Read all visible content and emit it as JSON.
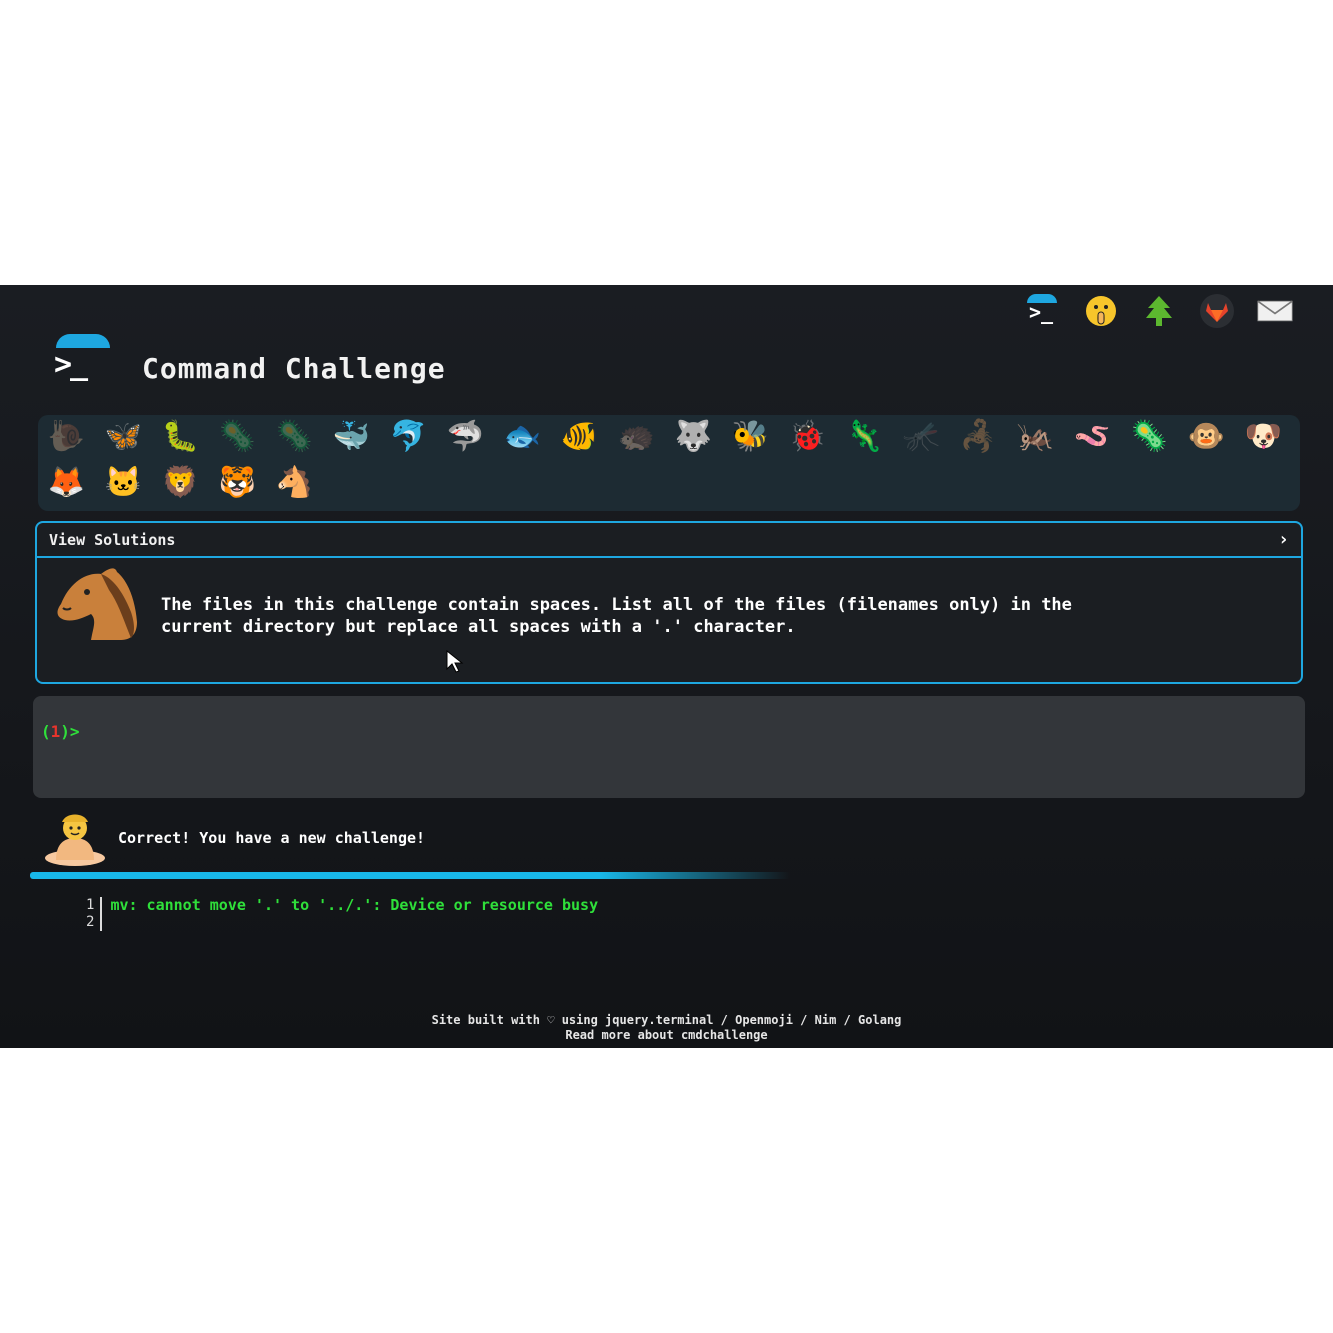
{
  "app": {
    "title": "Command Challenge",
    "logo_text": ">_"
  },
  "colors": {
    "accent": "#1ea7e0",
    "prompt_green": "#2fe03a",
    "prompt_red": "#e8342c",
    "background": "#15171b"
  },
  "nav": [
    {
      "name": "home-logo-icon"
    },
    {
      "name": "shush-face-icon"
    },
    {
      "name": "tree-icon"
    },
    {
      "name": "gitlab-icon"
    },
    {
      "name": "mail-icon"
    }
  ],
  "badges": {
    "row1": [
      {
        "icon": "🐌",
        "name": "snail",
        "dim": true
      },
      {
        "icon": "🦋",
        "name": "butterfly",
        "dim": false
      },
      {
        "icon": "🐛",
        "name": "caterpillar",
        "dim": false
      },
      {
        "icon": "🦠",
        "name": "microbe",
        "dim": true
      },
      {
        "icon": "🦠",
        "name": "germ",
        "dim": true
      },
      {
        "icon": "🐳",
        "name": "whale",
        "dim": false
      },
      {
        "icon": "🐬",
        "name": "dolphin",
        "dim": false
      },
      {
        "icon": "🦈",
        "name": "shark",
        "dim": false
      },
      {
        "icon": "🐟",
        "name": "fish",
        "dim": false
      },
      {
        "icon": "🐠",
        "name": "tropical-fish",
        "dim": false
      },
      {
        "icon": "🦔",
        "name": "hedgehog",
        "dim": true
      },
      {
        "icon": "🐺",
        "name": "wolf",
        "dim": false
      },
      {
        "icon": "🐝",
        "name": "bee",
        "dim": false
      },
      {
        "icon": "🐞",
        "name": "ladybug",
        "dim": false
      },
      {
        "icon": "🦎",
        "name": "lizard",
        "dim": false
      },
      {
        "icon": "🦟",
        "name": "mosquito",
        "dim": true
      },
      {
        "icon": "🦂",
        "name": "scorpion",
        "dim": true
      },
      {
        "icon": "🦗",
        "name": "cricket",
        "dim": false
      },
      {
        "icon": "🪱",
        "name": "worm",
        "dim": false
      },
      {
        "icon": "🦠",
        "name": "amoeba",
        "dim": false
      },
      {
        "icon": "🐵",
        "name": "monkey",
        "dim": false
      },
      {
        "icon": "🐶",
        "name": "dog",
        "dim": false
      }
    ],
    "row2": [
      {
        "icon": "🦊",
        "name": "fox",
        "dim": false
      },
      {
        "icon": "🐱",
        "name": "cat",
        "dim": false
      },
      {
        "icon": "🦁",
        "name": "lion",
        "dim": false
      },
      {
        "icon": "🐯",
        "name": "tiger",
        "dim": false
      },
      {
        "icon": "🐴",
        "name": "horse",
        "dim": false
      }
    ]
  },
  "challenge": {
    "view_solutions_label": "View Solutions",
    "chevron": "›",
    "description_line1": "The files in this challenge contain spaces. List all of the files (filenames only) in the",
    "description_line2": "current directory but replace all spaces with a '.' character."
  },
  "terminal": {
    "prompt_open": "(",
    "prompt_number": "1",
    "prompt_close": ")>"
  },
  "result": {
    "message": "Correct! You have a new challenge!"
  },
  "output": {
    "line_numbers": [
      "1",
      "2"
    ],
    "lines": [
      "mv: cannot move '.' to '../.': Device or resource busy"
    ]
  },
  "footer": {
    "line1_prefix": "Site built with",
    "heart": "♡",
    "line1_using": "using",
    "link_terminal": "jquery.terminal",
    "sep1": "/",
    "link_openmoji": "Openmoji",
    "sep2": "/",
    "link_nim": "Nim",
    "sep3": "/",
    "link_golang": "Golang",
    "line2": "Read more about cmdchallenge"
  }
}
